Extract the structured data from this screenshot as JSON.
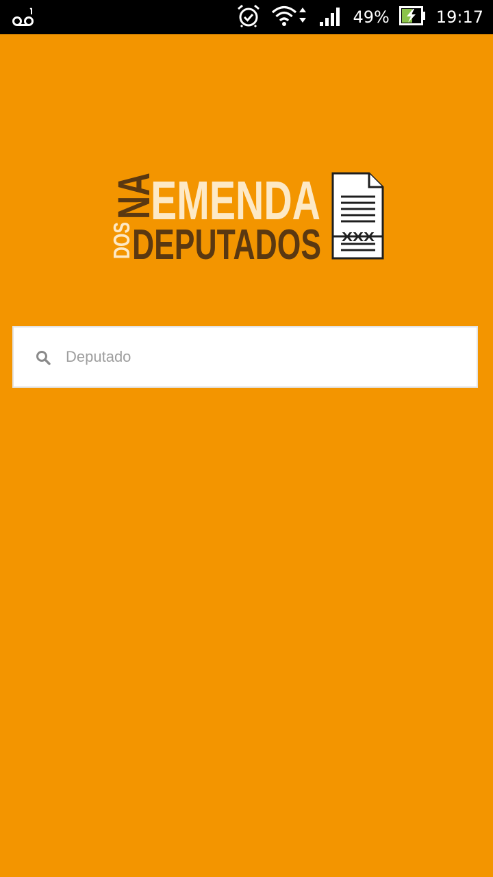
{
  "status_bar": {
    "left_icon": "voicemail-icon",
    "icons": [
      "alarm-icon",
      "wifi-icon",
      "signal-icon",
      "battery-charging-icon"
    ],
    "battery_percent": "49%",
    "time": "19:17"
  },
  "logo": {
    "line1_prefix": "NA",
    "line1": "EMENDA",
    "line2_prefix": "DOS",
    "line2": "DEPUTADOS",
    "document_marks": "XXX",
    "colors": {
      "light": "#fde9c6",
      "dark": "#5a3811"
    }
  },
  "search": {
    "placeholder": "Deputado",
    "value": "",
    "icon": "search-icon"
  },
  "colors": {
    "background": "#f39500",
    "status_bar": "#000000",
    "search_bg": "#ffffff",
    "placeholder": "#9e9e9e"
  }
}
